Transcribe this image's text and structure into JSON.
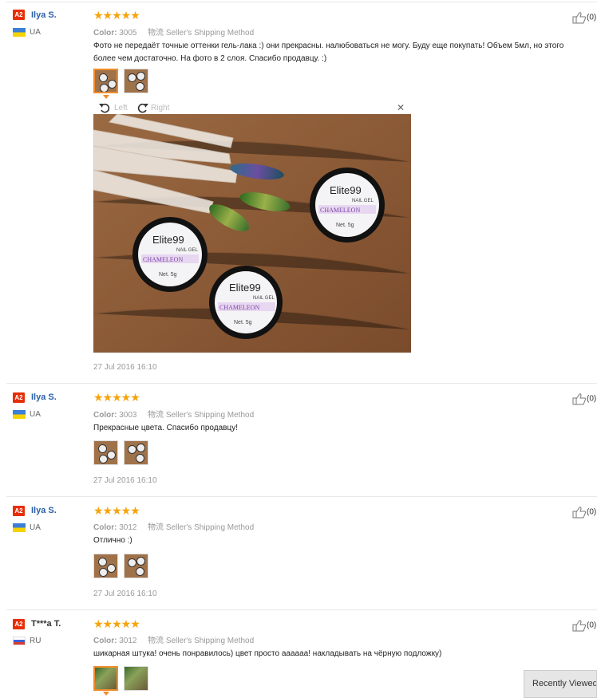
{
  "reviews": [
    {
      "badge": "A2",
      "name": "Ilya S.",
      "country": "UA",
      "stars": "★★★★★",
      "color_label": "Color:",
      "color_value": "3005",
      "shipping_label": "物流",
      "shipping_value": "Seller's Shipping Method",
      "text": "Фото не передаёт точные оттенки гель-лака :) они прекрасны. налюбоваться не могу. Буду еще покупать! Объем 5мл, но этого более чем достаточно. На фото в 2 слоя. Спасибо продавцу. :)",
      "date": "27 Jul 2016 16:10",
      "likes": "(0)"
    },
    {
      "badge": "A2",
      "name": "Ilya S.",
      "country": "UA",
      "stars": "★★★★★",
      "color_label": "Color:",
      "color_value": "3003",
      "shipping_label": "物流",
      "shipping_value": "Seller's Shipping Method",
      "text": "Прекрасные цвета. Спасибо продавцу!",
      "date": "27 Jul 2016 16:10",
      "likes": "(0)"
    },
    {
      "badge": "A2",
      "name": "Ilya S.",
      "country": "UA",
      "stars": "★★★★★",
      "color_label": "Color:",
      "color_value": "3012",
      "shipping_label": "物流",
      "shipping_value": "Seller's Shipping Method",
      "text": "Отлично :)",
      "date": "27 Jul 2016 16:10",
      "likes": "(0)"
    },
    {
      "badge": "A2",
      "name": "T***a T.",
      "country": "RU",
      "stars": "★★★★★",
      "color_label": "Color:",
      "color_value": "3012",
      "shipping_label": "物流",
      "shipping_value": "Seller's Shipping Method",
      "text": "шикарная штука! очень понравилось) цвет просто аааааа! накладывать на чёрную подложку)",
      "date": "",
      "likes": "(0)"
    }
  ],
  "viewer": {
    "left_label": "Left",
    "right_label": "Right",
    "photo": {
      "jars": [
        {
          "brand": "Elite99",
          "sub": "NAIL GEL",
          "band": "CHAMELEON",
          "net": "Net. 5g"
        },
        {
          "brand": "Elite99",
          "sub": "NAIL GEL",
          "band": "CHAMELEON",
          "net": "Net. 5g"
        },
        {
          "brand": "Elite99",
          "sub": "NAIL GEL",
          "band": "CHAMELEON",
          "net": "Net. 5g"
        }
      ]
    }
  },
  "recently_viewed": "Recently Viewed"
}
